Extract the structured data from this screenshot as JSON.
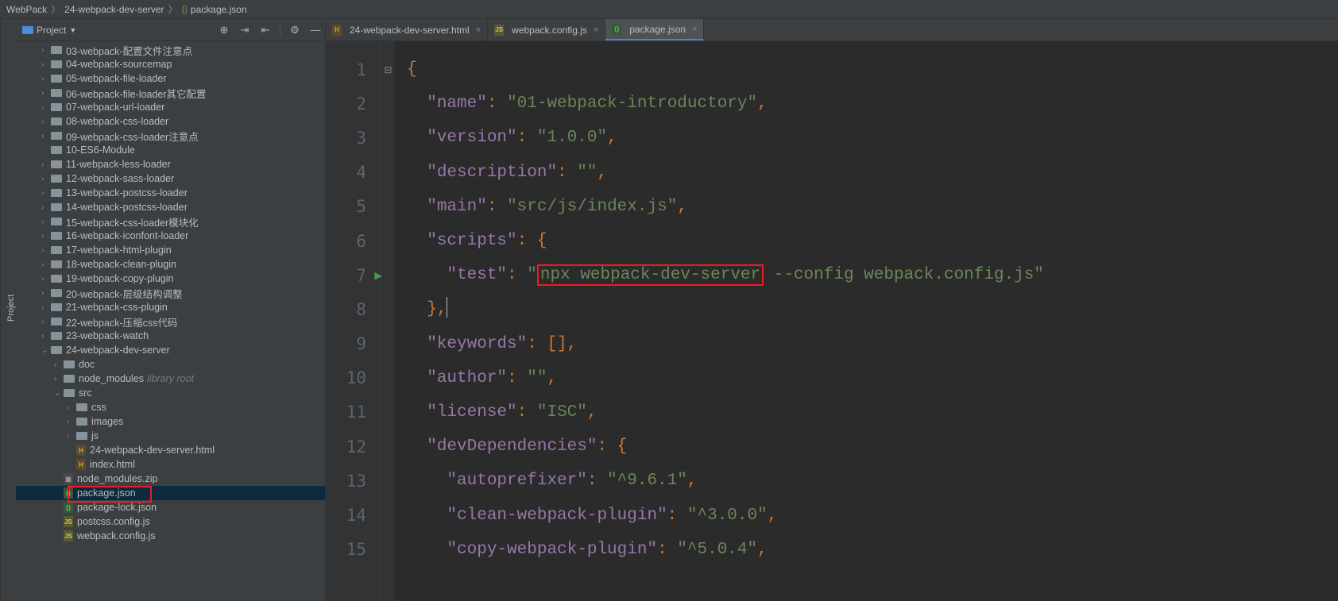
{
  "breadcrumb": {
    "root": "WebPack",
    "folder": "24-webpack-dev-server",
    "file": "package.json"
  },
  "sidebar": {
    "title": "Project",
    "vert_tab": "Project"
  },
  "toolbar": {
    "target_icon": "⊕",
    "collapse_icon": "⇥",
    "expand_icon": "⇤",
    "settings_icon": "⚙",
    "hide_icon": "—"
  },
  "tree": [
    {
      "d": 1,
      "t": "folder",
      "n": "03-webpack-配置文件注意点",
      "a": "›"
    },
    {
      "d": 1,
      "t": "folder",
      "n": "04-webpack-sourcemap",
      "a": "›"
    },
    {
      "d": 1,
      "t": "folder",
      "n": "05-webpack-file-loader",
      "a": "›"
    },
    {
      "d": 1,
      "t": "folder",
      "n": "06-webpack-file-loader其它配置",
      "a": "›"
    },
    {
      "d": 1,
      "t": "folder",
      "n": "07-webpack-url-loader",
      "a": "›"
    },
    {
      "d": 1,
      "t": "folder",
      "n": "08-webpack-css-loader",
      "a": "›"
    },
    {
      "d": 1,
      "t": "folder",
      "n": "09-webpack-css-loader注意点",
      "a": "›"
    },
    {
      "d": 1,
      "t": "folder",
      "n": "10-ES6-Module",
      "a": ""
    },
    {
      "d": 1,
      "t": "folder",
      "n": "11-webpack-less-loader",
      "a": "›"
    },
    {
      "d": 1,
      "t": "folder",
      "n": "12-webpack-sass-loader",
      "a": "›"
    },
    {
      "d": 1,
      "t": "folder",
      "n": "13-webpack-postcss-loader",
      "a": "›"
    },
    {
      "d": 1,
      "t": "folder",
      "n": "14-webpack-postcss-loader",
      "a": "›"
    },
    {
      "d": 1,
      "t": "folder",
      "n": "15-webpack-css-loader模块化",
      "a": "›"
    },
    {
      "d": 1,
      "t": "folder",
      "n": "16-webpack-iconfont-loader",
      "a": "›"
    },
    {
      "d": 1,
      "t": "folder",
      "n": "17-webpack-html-plugin",
      "a": "›"
    },
    {
      "d": 1,
      "t": "folder",
      "n": "18-webpack-clean-plugin",
      "a": "›"
    },
    {
      "d": 1,
      "t": "folder",
      "n": "19-webpack-copy-plugin",
      "a": "›"
    },
    {
      "d": 1,
      "t": "folder",
      "n": "20-webpack-层级结构调整",
      "a": "›"
    },
    {
      "d": 1,
      "t": "folder",
      "n": "21-webpack-css-plugin",
      "a": "›"
    },
    {
      "d": 1,
      "t": "folder",
      "n": "22-webpack-压缩css代码",
      "a": "›"
    },
    {
      "d": 1,
      "t": "folder",
      "n": "23-webpack-watch",
      "a": "›"
    },
    {
      "d": 1,
      "t": "folder",
      "n": "24-webpack-dev-server",
      "a": "⌄",
      "open": true
    },
    {
      "d": 2,
      "t": "folder",
      "n": "doc",
      "a": "›"
    },
    {
      "d": 2,
      "t": "folder",
      "n": "node_modules",
      "a": "›",
      "hint": "library root"
    },
    {
      "d": 2,
      "t": "folder",
      "n": "src",
      "a": "⌄",
      "open": true
    },
    {
      "d": 3,
      "t": "folder",
      "n": "css",
      "a": "›"
    },
    {
      "d": 3,
      "t": "folder",
      "n": "images",
      "a": "›"
    },
    {
      "d": 3,
      "t": "folder",
      "n": "js",
      "a": "›"
    },
    {
      "d": 3,
      "t": "file",
      "ft": "html",
      "n": "24-webpack-dev-server.html"
    },
    {
      "d": 3,
      "t": "file",
      "ft": "html",
      "n": "index.html"
    },
    {
      "d": 2,
      "t": "file",
      "ft": "zip",
      "n": "node_modules.zip"
    },
    {
      "d": 2,
      "t": "file",
      "ft": "json",
      "n": "package.json",
      "sel": true,
      "red": true
    },
    {
      "d": 2,
      "t": "file",
      "ft": "json",
      "n": "package-lock.json"
    },
    {
      "d": 2,
      "t": "file",
      "ft": "js",
      "n": "postcss.config.js"
    },
    {
      "d": 2,
      "t": "file",
      "ft": "js",
      "n": "webpack.config.js"
    }
  ],
  "tabs": [
    {
      "label": "24-webpack-dev-server.html",
      "ft": "html",
      "active": false
    },
    {
      "label": "webpack.config.js",
      "ft": "js",
      "active": false
    },
    {
      "label": "package.json",
      "ft": "json",
      "active": true
    }
  ],
  "code": {
    "line1": "{",
    "k_name": "\"name\"",
    "v_name": "\"01-webpack-introductory\"",
    "k_ver": "\"version\"",
    "v_ver": "\"1.0.0\"",
    "k_desc": "\"description\"",
    "v_desc": "\"\"",
    "k_main": "\"main\"",
    "v_main": "\"src/js/index.js\"",
    "k_scripts": "\"scripts\"",
    "k_test": "\"test\"",
    "v_test_q": "\"",
    "v_test_hl": "npx webpack-dev-server",
    "v_test_rest": " --config webpack.config.js\"",
    "k_kw": "\"keywords\"",
    "k_auth": "\"author\"",
    "v_auth": "\"\"",
    "k_lic": "\"license\"",
    "v_lic": "\"ISC\"",
    "k_dev": "\"devDependencies\"",
    "k_auto": "\"autoprefixer\"",
    "v_auto": "\"^9.6.1\"",
    "k_clean": "\"clean-webpack-plugin\"",
    "v_clean": "\"^3.0.0\"",
    "k_copy": "\"copy-webpack-plugin\"",
    "v_copy": "\"^5.0.4\""
  },
  "line_numbers": [
    "1",
    "2",
    "3",
    "4",
    "5",
    "6",
    "7",
    "8",
    "9",
    "10",
    "11",
    "12",
    "13",
    "14",
    "15"
  ]
}
